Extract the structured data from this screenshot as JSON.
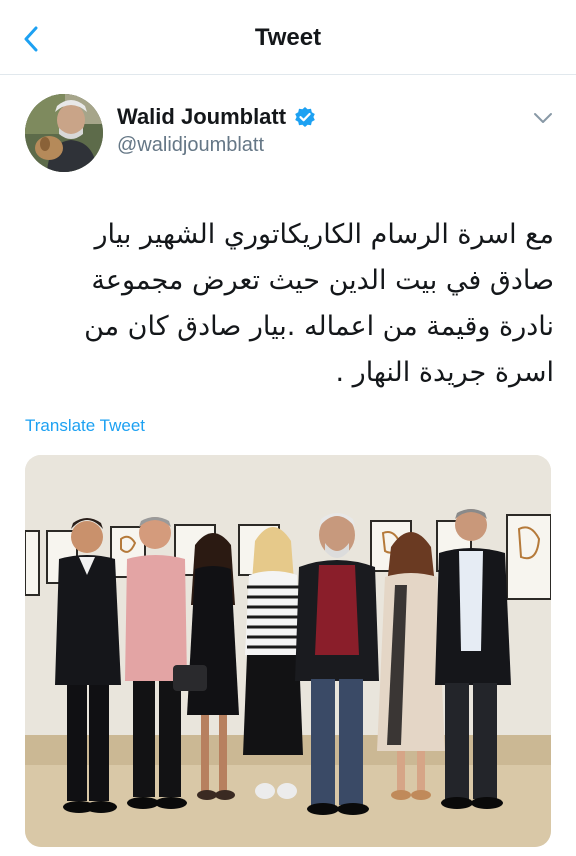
{
  "header": {
    "title": "Tweet",
    "back_icon": "chevron-left-icon"
  },
  "author": {
    "name": "Walid Joumblatt",
    "handle": "@walidjoumblatt",
    "verified_icon": "verified-badge-icon",
    "menu_icon": "chevron-down-icon"
  },
  "tweet": {
    "text_lines": [
      "مع اسرة الرسام الكاريكاتوري الشهير بيار",
      "صادق في بيت الدين حيث تعرض مجموعة",
      "نادرة وقيمة من اعماله .بيار صادق كان من",
      "اسرة جريدة النهار ."
    ],
    "translate_label": "Translate Tweet"
  },
  "colors": {
    "accent": "#1da1f2",
    "text_primary": "#14171a",
    "text_secondary": "#657786",
    "divider": "#e1e8ed"
  }
}
